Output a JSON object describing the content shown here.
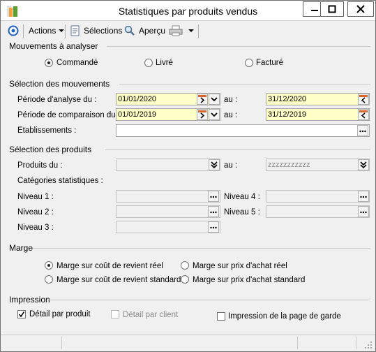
{
  "window": {
    "title": "Statistiques par produits vendus",
    "controls": {
      "minimize": "—",
      "maximize": "□",
      "close": "✕"
    }
  },
  "toolbar": {
    "actions_label": "Actions",
    "selections_label": "Sélections",
    "apercu_label": "Aperçu"
  },
  "mouvements": {
    "title": "Mouvements à analyser",
    "options": [
      {
        "label": "Commandé",
        "selected": true
      },
      {
        "label": "Livré",
        "selected": false
      },
      {
        "label": "Facturé",
        "selected": false
      }
    ]
  },
  "selection_mouvements": {
    "title": "Sélection des mouvements",
    "periode_analyse_label": "Période d'analyse du :",
    "periode_analyse_from": "01/01/2020",
    "periode_analyse_to": "31/12/2020",
    "periode_comparaison_label": "Période de comparaison du :",
    "periode_comparaison_from": "01/01/2019",
    "periode_comparaison_to": "31/12/2019",
    "au_label": "au :",
    "etablissements_label": "Etablissements :",
    "etablissements_value": ""
  },
  "selection_produits": {
    "title": "Sélection des produits",
    "produits_du_label": "Produits du :",
    "produits_du_value": "",
    "produits_au_value": "zzzzzzzzzzz",
    "au_label": "au :",
    "categories_label": "Catégories statistiques :",
    "niveau1_label": "Niveau 1 :",
    "niveau2_label": "Niveau 2 :",
    "niveau3_label": "Niveau 3 :",
    "niveau4_label": "Niveau 4 :",
    "niveau5_label": "Niveau 5 :"
  },
  "marge": {
    "title": "Marge",
    "options": [
      {
        "label": "Marge sur coût de revient réel",
        "selected": true
      },
      {
        "label": "Marge sur prix d'achat réel",
        "selected": false
      },
      {
        "label": "Marge sur coût de revient standard",
        "selected": false
      },
      {
        "label": "Marge sur prix d'achat standard",
        "selected": false
      }
    ]
  },
  "impression": {
    "title": "Impression",
    "detail_produit_label": "Détail par produit",
    "detail_produit_checked": true,
    "detail_client_label": "Détail par client",
    "detail_client_checked": false,
    "page_garde_label": "Impression de la page de garde",
    "page_garde_checked": false
  },
  "colors": {
    "required_field": "#ffffc8",
    "disabled_text": "#8a8a8a",
    "accent_blue": "#1f5fbf"
  }
}
